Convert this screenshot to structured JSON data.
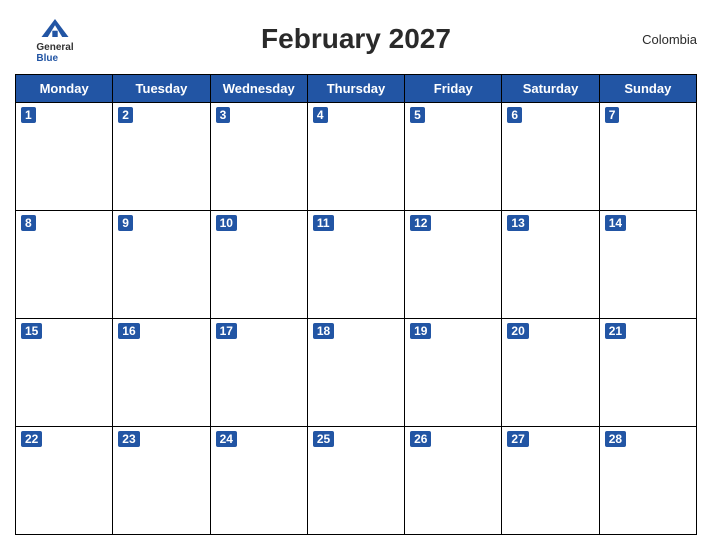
{
  "header": {
    "logo_general": "General",
    "logo_blue": "Blue",
    "title": "February 2027",
    "country": "Colombia"
  },
  "calendar": {
    "days": [
      "Monday",
      "Tuesday",
      "Wednesday",
      "Thursday",
      "Friday",
      "Saturday",
      "Sunday"
    ],
    "weeks": [
      [
        1,
        2,
        3,
        4,
        5,
        6,
        7
      ],
      [
        8,
        9,
        10,
        11,
        12,
        13,
        14
      ],
      [
        15,
        16,
        17,
        18,
        19,
        20,
        21
      ],
      [
        22,
        23,
        24,
        25,
        26,
        27,
        28
      ]
    ]
  }
}
